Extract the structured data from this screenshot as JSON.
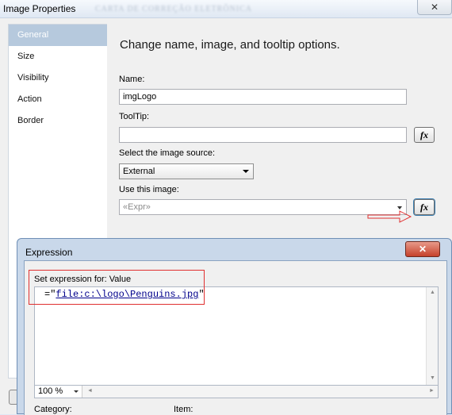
{
  "window": {
    "title": "Image Properties",
    "close_glyph": "✕",
    "blurred_caption": "CARTA DE CORREÇÃO ELETRÔNICA"
  },
  "sidebar": {
    "items": [
      "General",
      "Size",
      "Visibility",
      "Action",
      "Border"
    ],
    "selected": "General"
  },
  "main": {
    "heading": "Change name, image, and tooltip options.",
    "name_label": "Name:",
    "name_value": "imgLogo",
    "tooltip_label": "ToolTip:",
    "tooltip_value": "",
    "fx_label": "fx",
    "source_label": "Select the image source:",
    "source_value": "External",
    "use_image_label": "Use this image:",
    "use_image_value": "«Expr»"
  },
  "expression": {
    "title": "Expression",
    "close_glyph": "✕",
    "set_label": "Set expression for: Value",
    "code_prefix": "=",
    "code_quote_open": "\"",
    "code_string": "file:c:\\logo\\Penguins.jpg",
    "code_quote_close": "\"",
    "zoom": "100 %",
    "category_label": "Category:",
    "item_label": "Item:"
  },
  "colors": {
    "selected_bg": "#b6c9dd",
    "highlight_red": "#e03030",
    "expression_frame": "#c9d8ea"
  }
}
